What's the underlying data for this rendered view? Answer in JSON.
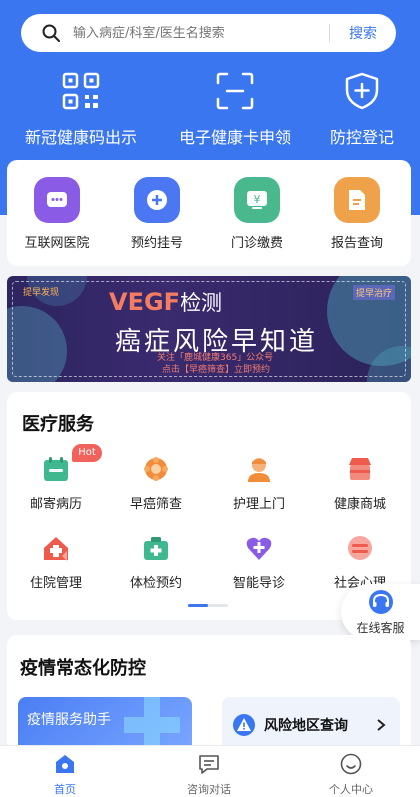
{
  "search": {
    "placeholder": "输入病症/科室/医生名搜索",
    "button": "搜索"
  },
  "quick_actions": [
    {
      "label": "新冠健康码出示",
      "icon": "qr-code-icon"
    },
    {
      "label": "电子健康卡申领",
      "icon": "scan-card-icon"
    },
    {
      "label": "防控登记",
      "icon": "shield-plus-icon"
    }
  ],
  "services": [
    {
      "label": "互联网医院",
      "icon": "chat-dots-icon",
      "color": "#8a5ce6"
    },
    {
      "label": "预约挂号",
      "icon": "plus-diamond-icon",
      "color": "#4b78f2"
    },
    {
      "label": "门诊缴费",
      "icon": "yen-card-icon",
      "color": "#49b98d"
    },
    {
      "label": "报告查询",
      "icon": "document-icon",
      "color": "#f0a24a"
    }
  ],
  "banner": {
    "tag_left": "提早发现",
    "tag_right": "提早治疗",
    "title_main": "VEGF",
    "title_suffix": "检测",
    "slogan": "癌症风险早知道",
    "line1": "关注「鹿城健康365」公众号",
    "line2": "点击【早癌筛查】立即预约"
  },
  "medical": {
    "title": "医疗服务",
    "hot_badge": "Hot",
    "items": [
      {
        "label": "邮寄病历",
        "icon": "calendar-icon",
        "color": "#3fb88f"
      },
      {
        "label": "早癌筛查",
        "icon": "flower-icon",
        "color": "#f08c3a"
      },
      {
        "label": "护理上门",
        "icon": "nurse-icon",
        "color": "#f08c3a"
      },
      {
        "label": "健康商城",
        "icon": "store-icon",
        "color": "#ee5a4c"
      },
      {
        "label": "住院管理",
        "icon": "hospital-icon",
        "color": "#ee5a4c"
      },
      {
        "label": "体检预约",
        "icon": "medical-kit-icon",
        "color": "#3fb88f"
      },
      {
        "label": "智能导诊",
        "icon": "guide-heart-icon",
        "color": "#8a5ce6"
      },
      {
        "label": "社会心理",
        "icon": "psychology-icon",
        "color": "#ee5a4c"
      }
    ]
  },
  "customer_service": {
    "label": "在线客服"
  },
  "epidemic": {
    "title": "疫情常态化防控",
    "assistant": "疫情服务助手",
    "risk_query": "风险地区查询"
  },
  "tabbar": [
    {
      "label": "首页",
      "icon": "home-icon",
      "active": true
    },
    {
      "label": "咨询对话",
      "icon": "chat-icon",
      "active": false
    },
    {
      "label": "个人中心",
      "icon": "user-face-icon",
      "active": false
    }
  ]
}
